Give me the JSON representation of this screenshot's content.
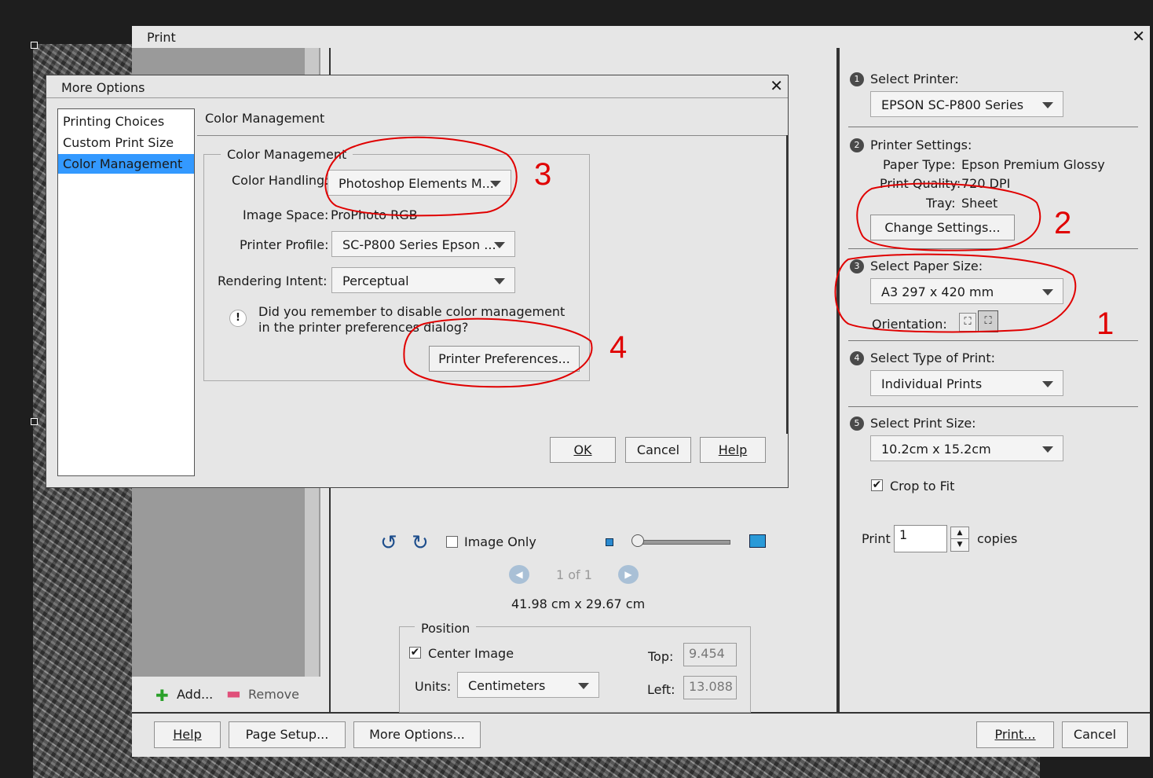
{
  "print_window": {
    "title": "Print",
    "close_label": "✕",
    "preview": {
      "image_only_label": "Image Only",
      "page_indicator": "1 of 1",
      "dimensions": "41.98 cm x 29.67 cm",
      "position_group": "Position",
      "center_image_label": "Center Image",
      "units_label": "Units:",
      "units_value": "Centimeters",
      "top_label": "Top:",
      "top_value": "9.454",
      "left_label": "Left:",
      "left_value": "13.088"
    },
    "left_panel": {
      "add_label": "Add...",
      "remove_label": "Remove"
    },
    "settings": {
      "step1_label": "Select Printer:",
      "printer_value": "EPSON SC-P800 Series",
      "step2_label": "Printer Settings:",
      "paper_type_label": "Paper Type:",
      "paper_type_value": "Epson Premium Glossy",
      "print_quality_label": "Print Quality:",
      "print_quality_value": "720 DPI",
      "tray_label": "Tray:",
      "tray_value": "Sheet",
      "change_settings_label": "Change Settings...",
      "step3_label": "Select Paper Size:",
      "paper_size_value": "A3 297 x 420 mm",
      "orientation_label": "Orientation:",
      "step4_label": "Select Type of Print:",
      "print_type_value": "Individual Prints",
      "step5_label": "Select Print Size:",
      "print_size_value": "10.2cm x 15.2cm",
      "crop_label": "Crop to Fit",
      "print_label": "Print",
      "copies_value": "1",
      "copies_label": "copies"
    },
    "bottom": {
      "help_label": "Help",
      "page_setup_label": "Page Setup...",
      "more_options_label": "More Options...",
      "print_label": "Print...",
      "cancel_label": "Cancel"
    },
    "step_numbers": [
      "1",
      "2",
      "3",
      "4",
      "5"
    ]
  },
  "more_options": {
    "title": "More Options",
    "close_label": "✕",
    "nav_items": [
      "Printing Choices",
      "Custom Print Size",
      "Color Management"
    ],
    "section_title": "Color Management",
    "group_title": "Color Management",
    "color_handling_label": "Color Handling:",
    "color_handling_value": "Photoshop Elements M...",
    "image_space_label": "Image Space:",
    "image_space_value": "ProPhoto RGB",
    "printer_profile_label": "Printer Profile:",
    "printer_profile_value": "SC-P800 Series Epson ...",
    "rendering_intent_label": "Rendering Intent:",
    "rendering_intent_value": "Perceptual",
    "warning_line1": "Did you remember to disable color management",
    "warning_line2": "in the printer preferences dialog?",
    "printer_prefs_label": "Printer Preferences...",
    "ok_label": "OK",
    "cancel_label": "Cancel",
    "help_label": "Help"
  },
  "annotations": [
    "3",
    "2",
    "1",
    "4"
  ],
  "colors": {
    "annotation": "#e00000",
    "selection": "#3399ff",
    "window_bg": "#e6e6e6"
  }
}
